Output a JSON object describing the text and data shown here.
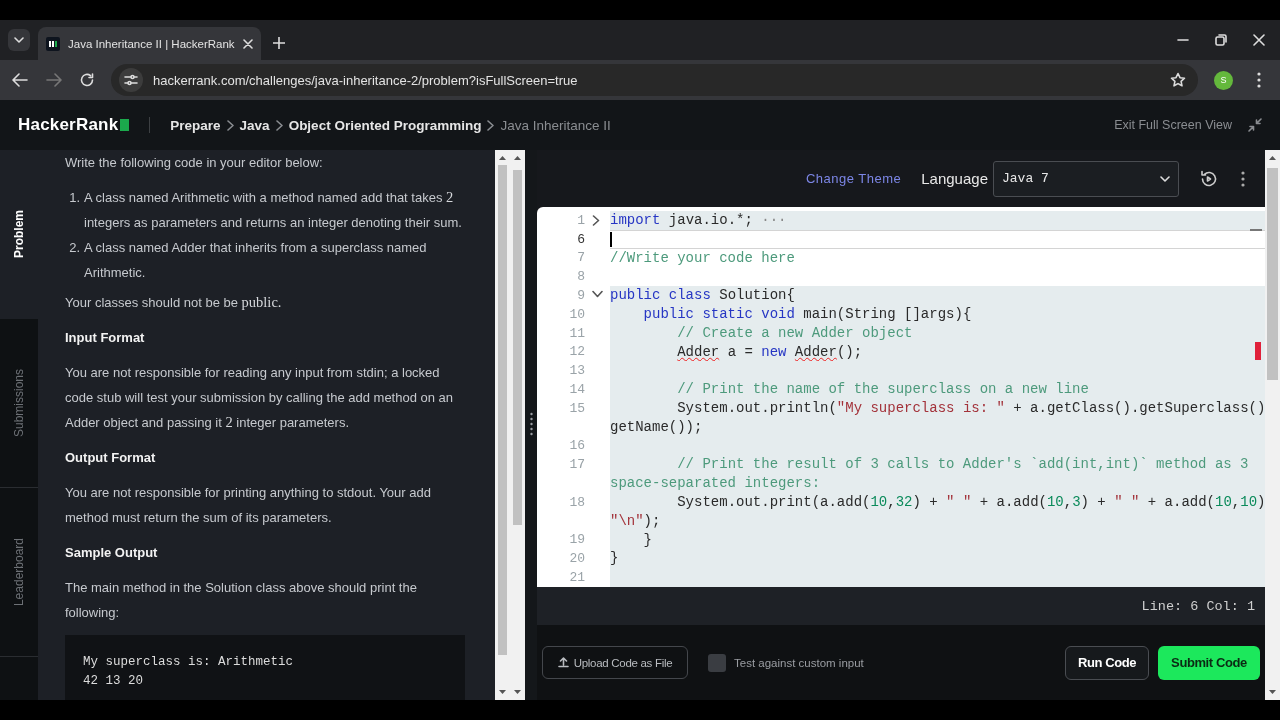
{
  "browser": {
    "tab_title": "Java Inheritance II | HackerRank",
    "url": "hackerrank.com/challenges/java-inheritance-2/problem?isFullScreen=true",
    "profile_initial": "S"
  },
  "header": {
    "logo": "HackerRank",
    "breadcrumbs": [
      {
        "label": "Prepare",
        "current": false
      },
      {
        "label": "Java",
        "current": false
      },
      {
        "label": "Object Oriented Programming",
        "current": false
      },
      {
        "label": "Java Inheritance II",
        "current": true
      }
    ],
    "exit_label": "Exit Full Screen View"
  },
  "side_tabs": [
    {
      "label": "Problem",
      "selected": true
    },
    {
      "label": "Submissions",
      "selected": false
    },
    {
      "label": "Leaderboard",
      "selected": false
    }
  ],
  "problem": {
    "blocks": [
      {
        "kind": "paragraph",
        "segments": [
          {
            "text": "Write the following code in your editor below:",
            "kind": "text"
          }
        ]
      },
      {
        "kind": "list",
        "items": [
          {
            "number": "1.",
            "segments": [
              {
                "text": "A class named Arithmetic with a method named add that takes ",
                "kind": "text"
              },
              {
                "text": "2",
                "kind": "math"
              },
              {
                "text": " integers as parameters and returns an integer denoting their sum.",
                "kind": "text"
              }
            ]
          },
          {
            "number": "2.",
            "segments": [
              {
                "text": "A class named Adder that inherits from a superclass named Arithmetic.",
                "kind": "text"
              }
            ]
          }
        ]
      },
      {
        "kind": "paragraph",
        "segments": [
          {
            "text": "Your classes should not be be ",
            "kind": "text"
          },
          {
            "text": "public.",
            "kind": "math"
          }
        ]
      },
      {
        "kind": "heading",
        "text": "Input Format"
      },
      {
        "kind": "paragraph",
        "segments": [
          {
            "text": "You are not responsible for reading any input from stdin; a locked code stub will test your submission by calling the add method on an Adder object and passing it ",
            "kind": "text"
          },
          {
            "text": "2",
            "kind": "math"
          },
          {
            "text": " integer parameters.",
            "kind": "text"
          }
        ]
      },
      {
        "kind": "heading",
        "text": "Output Format"
      },
      {
        "kind": "paragraph",
        "segments": [
          {
            "text": "You are not responsible for printing anything to stdout. Your add method must return the sum of its parameters.",
            "kind": "text"
          }
        ]
      },
      {
        "kind": "heading",
        "text": "Sample Output"
      },
      {
        "kind": "paragraph",
        "segments": [
          {
            "text": "The main method in the Solution class above should print the following:",
            "kind": "text"
          }
        ]
      },
      {
        "kind": "code",
        "lines": [
          "My superclass is: Arithmetic",
          "42 13 20"
        ]
      }
    ]
  },
  "editor": {
    "change_theme": "Change Theme",
    "language_label": "Language",
    "language": "Java 7",
    "lines": [
      {
        "number": "1",
        "collapsed": true,
        "selected": true,
        "current": false,
        "rows": [
          [
            {
              "text": "import",
              "kind": "keyword"
            },
            {
              "text": " java.io.*;",
              "kind": "plain"
            },
            {
              "text": " ···",
              "kind": "ellipsis"
            }
          ]
        ]
      },
      {
        "number": "6",
        "selected": false,
        "current": true,
        "rows": [
          []
        ]
      },
      {
        "number": "7",
        "selected": false,
        "current": false,
        "rows": [
          [
            {
              "text": "//Write your code here",
              "kind": "comment"
            }
          ]
        ]
      },
      {
        "number": "8",
        "selected": false,
        "current": false,
        "rows": [
          []
        ]
      },
      {
        "number": "9",
        "collapsed": false,
        "selected": true,
        "current": false,
        "rows": [
          [
            {
              "text": "public class",
              "kind": "keyword"
            },
            {
              "text": " Solution{",
              "kind": "plain"
            }
          ]
        ]
      },
      {
        "number": "10",
        "selected": true,
        "current": false,
        "rows": [
          [
            {
              "text": "    public static void",
              "kind": "keyword"
            },
            {
              "text": " main(String []args){",
              "kind": "plain"
            }
          ]
        ]
      },
      {
        "number": "11",
        "selected": true,
        "current": false,
        "rows": [
          [
            {
              "text": "        // Create a new Adder object",
              "kind": "comment"
            }
          ]
        ]
      },
      {
        "number": "12",
        "selected": true,
        "current": false,
        "rows": [
          [
            {
              "text": "        Adder",
              "kind": "error"
            },
            {
              "text": " a = ",
              "kind": "plain"
            },
            {
              "text": "new ",
              "kind": "keyword"
            },
            {
              "text": "Adder",
              "kind": "error"
            },
            {
              "text": "();",
              "kind": "plain"
            }
          ]
        ]
      },
      {
        "number": "13",
        "selected": true,
        "current": false,
        "rows": [
          []
        ]
      },
      {
        "number": "14",
        "selected": true,
        "current": false,
        "rows": [
          [
            {
              "text": "        // Print the name of the superclass on a new line",
              "kind": "comment"
            }
          ]
        ]
      },
      {
        "number": "15",
        "selected": true,
        "current": false,
        "rows": [
          [
            {
              "text": "        System.out.println(",
              "kind": "plain"
            },
            {
              "text": "\"My superclass is: \"",
              "kind": "string"
            },
            {
              "text": " + a.getClass().getSuperclass()",
              "kind": "plain"
            }
          ],
          [
            {
              "text": "getName());",
              "kind": "plain"
            }
          ]
        ]
      },
      {
        "number": "16",
        "selected": true,
        "current": false,
        "rows": [
          []
        ]
      },
      {
        "number": "17",
        "selected": true,
        "current": false,
        "rows": [
          [
            {
              "text": "        // Print the result of 3 calls to Adder's `add(int,int)` method as 3",
              "kind": "comment"
            }
          ],
          [
            {
              "text": "space-separated integers:",
              "kind": "comment"
            }
          ]
        ]
      },
      {
        "number": "18",
        "selected": true,
        "current": false,
        "rows": [
          [
            {
              "text": "        System.out.print(a.add(",
              "kind": "plain"
            },
            {
              "text": "10",
              "kind": "number"
            },
            {
              "text": ",",
              "kind": "plain"
            },
            {
              "text": "32",
              "kind": "number"
            },
            {
              "text": ") + ",
              "kind": "plain"
            },
            {
              "text": "\" \"",
              "kind": "string"
            },
            {
              "text": " + a.add(",
              "kind": "plain"
            },
            {
              "text": "10",
              "kind": "number"
            },
            {
              "text": ",",
              "kind": "plain"
            },
            {
              "text": "3",
              "kind": "number"
            },
            {
              "text": ") + ",
              "kind": "plain"
            },
            {
              "text": "\" \"",
              "kind": "string"
            },
            {
              "text": " + a.add(",
              "kind": "plain"
            },
            {
              "text": "10",
              "kind": "number"
            },
            {
              "text": ",",
              "kind": "plain"
            },
            {
              "text": "10",
              "kind": "number"
            },
            {
              "text": ")",
              "kind": "plain"
            }
          ],
          [
            {
              "text": "\"\\n\"",
              "kind": "string"
            },
            {
              "text": ");",
              "kind": "plain"
            }
          ]
        ]
      },
      {
        "number": "19",
        "selected": true,
        "current": false,
        "rows": [
          [
            {
              "text": "    }",
              "kind": "plain"
            }
          ]
        ]
      },
      {
        "number": "20",
        "selected": true,
        "current": false,
        "rows": [
          [
            {
              "text": "}",
              "kind": "plain"
            }
          ]
        ]
      },
      {
        "number": "21",
        "selected": true,
        "current": false,
        "rows": [
          []
        ]
      }
    ],
    "status": "Line: 6 Col: 1",
    "upload_button": "Upload Code as File",
    "custom_input": {
      "label": "Test against custom input",
      "checked": false
    },
    "run_button": "Run Code",
    "submit_button": "Submit Code"
  }
}
